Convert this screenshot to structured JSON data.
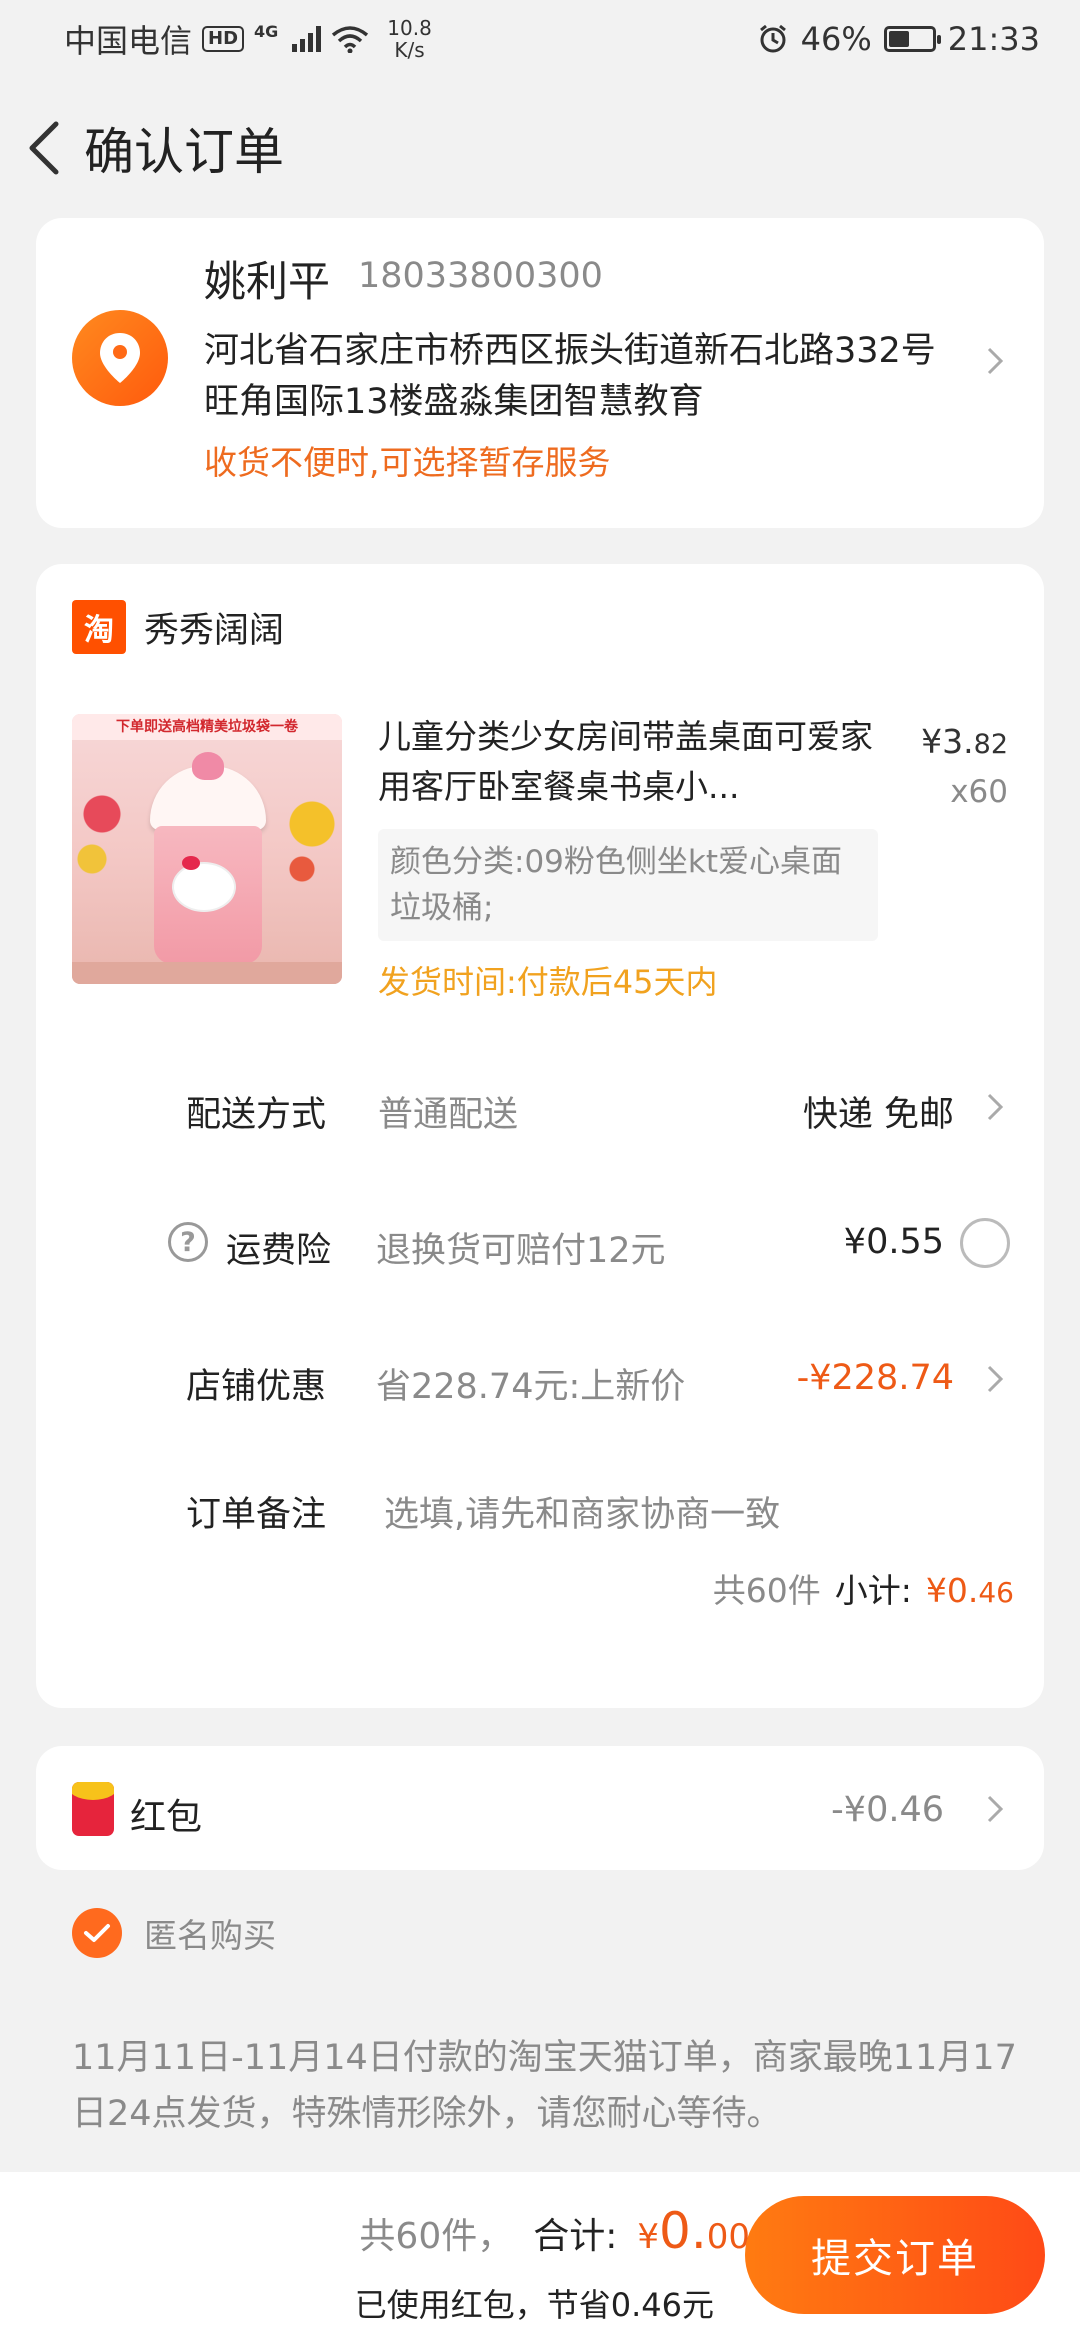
{
  "status_bar": {
    "carrier": "中国电信",
    "hd": "HD",
    "network": "4G",
    "speed_value": "10.8",
    "speed_unit": "K/s",
    "battery_percent": "46%",
    "battery_level": 0.46,
    "time": "21:33"
  },
  "header": {
    "title": "确认订单"
  },
  "address": {
    "name": "姚利平",
    "phone": "18033800300",
    "line1": "河北省石家庄市桥西区振头街道新石北路332号",
    "line2": "旺角国际13楼盛淼集团智慧教育",
    "tip": "收货不便时,可选择暂存服务"
  },
  "shop": {
    "logo_text": "淘",
    "name": "秀秀阔阔"
  },
  "product": {
    "title": "儿童分类少女房间带盖桌面可爱家用客厅卧室餐桌书桌小...",
    "price_symbol": "¥",
    "price_int": "3.",
    "price_dec": "82",
    "quantity": "x60",
    "sku": "颜色分类:09粉色侧坐kt爱心桌面垃圾桶;",
    "ship_time": "发货时间:付款后45天内",
    "image_banner": "下单即送高档精美垃圾袋一卷"
  },
  "delivery": {
    "label": "配送方式",
    "value": "普通配送",
    "right": "快递 免邮"
  },
  "insurance": {
    "label": "运费险",
    "value": "退换货可赔付12元",
    "right": "¥0.55"
  },
  "discount": {
    "label": "店铺优惠",
    "value": "省228.74元:上新价",
    "right": "-¥228.74"
  },
  "note": {
    "label": "订单备注",
    "placeholder": "选填,请先和商家协商一致"
  },
  "subtotal": {
    "count": "共60件",
    "label": "小计:",
    "symbol": "¥",
    "int": "0.",
    "dec": "46"
  },
  "redpack": {
    "label": "红包",
    "amount": "-¥0.46"
  },
  "anonymous": {
    "label": "匿名购买",
    "checked": true
  },
  "notice": "11月11日-11月14日付款的淘宝天猫订单，商家最晚11月17日24点发货，特殊情形除外，请您耐心等待。",
  "bottom": {
    "count": "共60件，",
    "total_label": "合计:",
    "symbol": "¥",
    "int": "0.",
    "dec": "00",
    "saved": "已使用红包，节省0.46元",
    "submit": "提交订单"
  },
  "colors": {
    "accent": "#ee5a16",
    "yellow": "#f1a21f",
    "gray": "#8a8a8a"
  }
}
